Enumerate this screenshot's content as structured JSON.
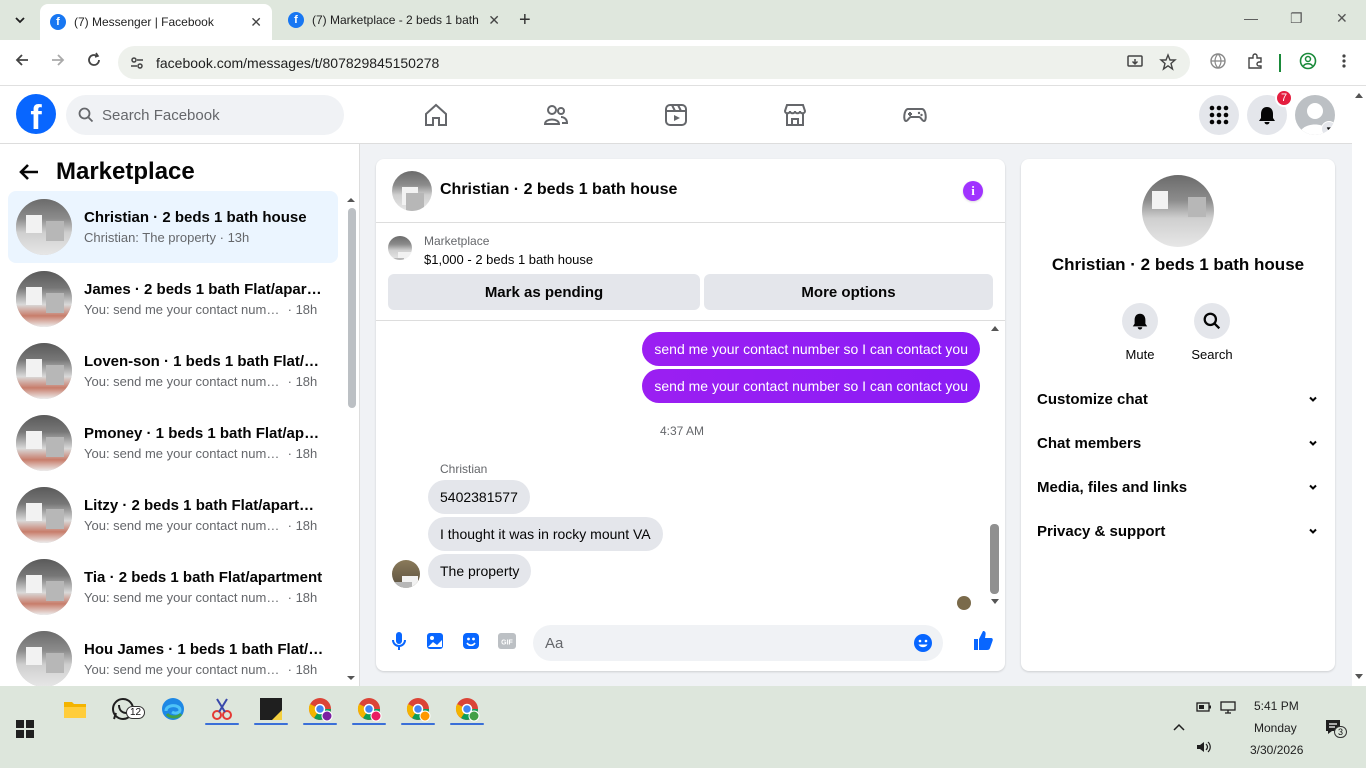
{
  "browser": {
    "tabs": [
      {
        "title": "(7) Messenger | Facebook",
        "active": true
      },
      {
        "title": "(7) Marketplace - 2 beds 1 bath",
        "active": false
      }
    ],
    "url": "facebook.com/messages/t/807829845150278"
  },
  "fb_header": {
    "search_placeholder": "Search Facebook",
    "notification_count": "7"
  },
  "left_pane": {
    "title": "Marketplace",
    "chats": [
      {
        "name": "Christian · 2 beds 1 bath house",
        "preview": "Christian: The property",
        "time": "· 13h",
        "selected": true
      },
      {
        "name": "James · 2 beds 1 bath Flat/apart...",
        "preview": "You: send me your contact numb...",
        "time": "· 18h",
        "selected": false
      },
      {
        "name": "Loven-son · 1 beds 1 bath Flat/a...",
        "preview": "You: send me your contact numb...",
        "time": "· 18h",
        "selected": false
      },
      {
        "name": "Pmoney · 1 beds 1 bath Flat/apar...",
        "preview": "You: send me your contact numb...",
        "time": "· 18h",
        "selected": false
      },
      {
        "name": "Litzy · 2 beds 1 bath Flat/apartm...",
        "preview": "You: send me your contact numb...",
        "time": "· 18h",
        "selected": false
      },
      {
        "name": "Tia · 2 beds 1 bath Flat/apartment",
        "preview": "You: send me your contact numb...",
        "time": "· 18h",
        "selected": false
      },
      {
        "name": "Hou James · 1 beds 1 bath Flat/a...",
        "preview": "You: send me your contact numb...",
        "time": "· 18h",
        "selected": false
      }
    ]
  },
  "conversation": {
    "title": "Christian · 2 beds 1 bath house",
    "marketplace_label": "Marketplace",
    "listing": "$1,000 - 2 beds 1 bath house",
    "mark_pending": "Mark as pending",
    "more_options": "More options",
    "outgoing": [
      "send me your contact number so I can contact you",
      "send me your contact number so I can contact you"
    ],
    "timestamp": "4:37 AM",
    "sender": "Christian",
    "incoming": [
      "5402381577",
      "I thought it was in rocky mount VA",
      "The property"
    ],
    "composer_placeholder": "Aa"
  },
  "info_panel": {
    "name": "Christian · 2 beds 1 bath house",
    "actions": [
      "Mute",
      "Search"
    ],
    "sections": [
      "Customize chat",
      "Chat members",
      "Media, files and links",
      "Privacy & support"
    ]
  },
  "taskbar": {
    "whatsapp_badge": "12",
    "time": "5:41 PM",
    "day": "Monday",
    "date": "3/30/2026",
    "notif_count": "3"
  },
  "colors": {
    "fb_blue": "#0866ff",
    "messenger_purple": "#8a1cf5",
    "selected_bg": "#ebf5ff"
  }
}
